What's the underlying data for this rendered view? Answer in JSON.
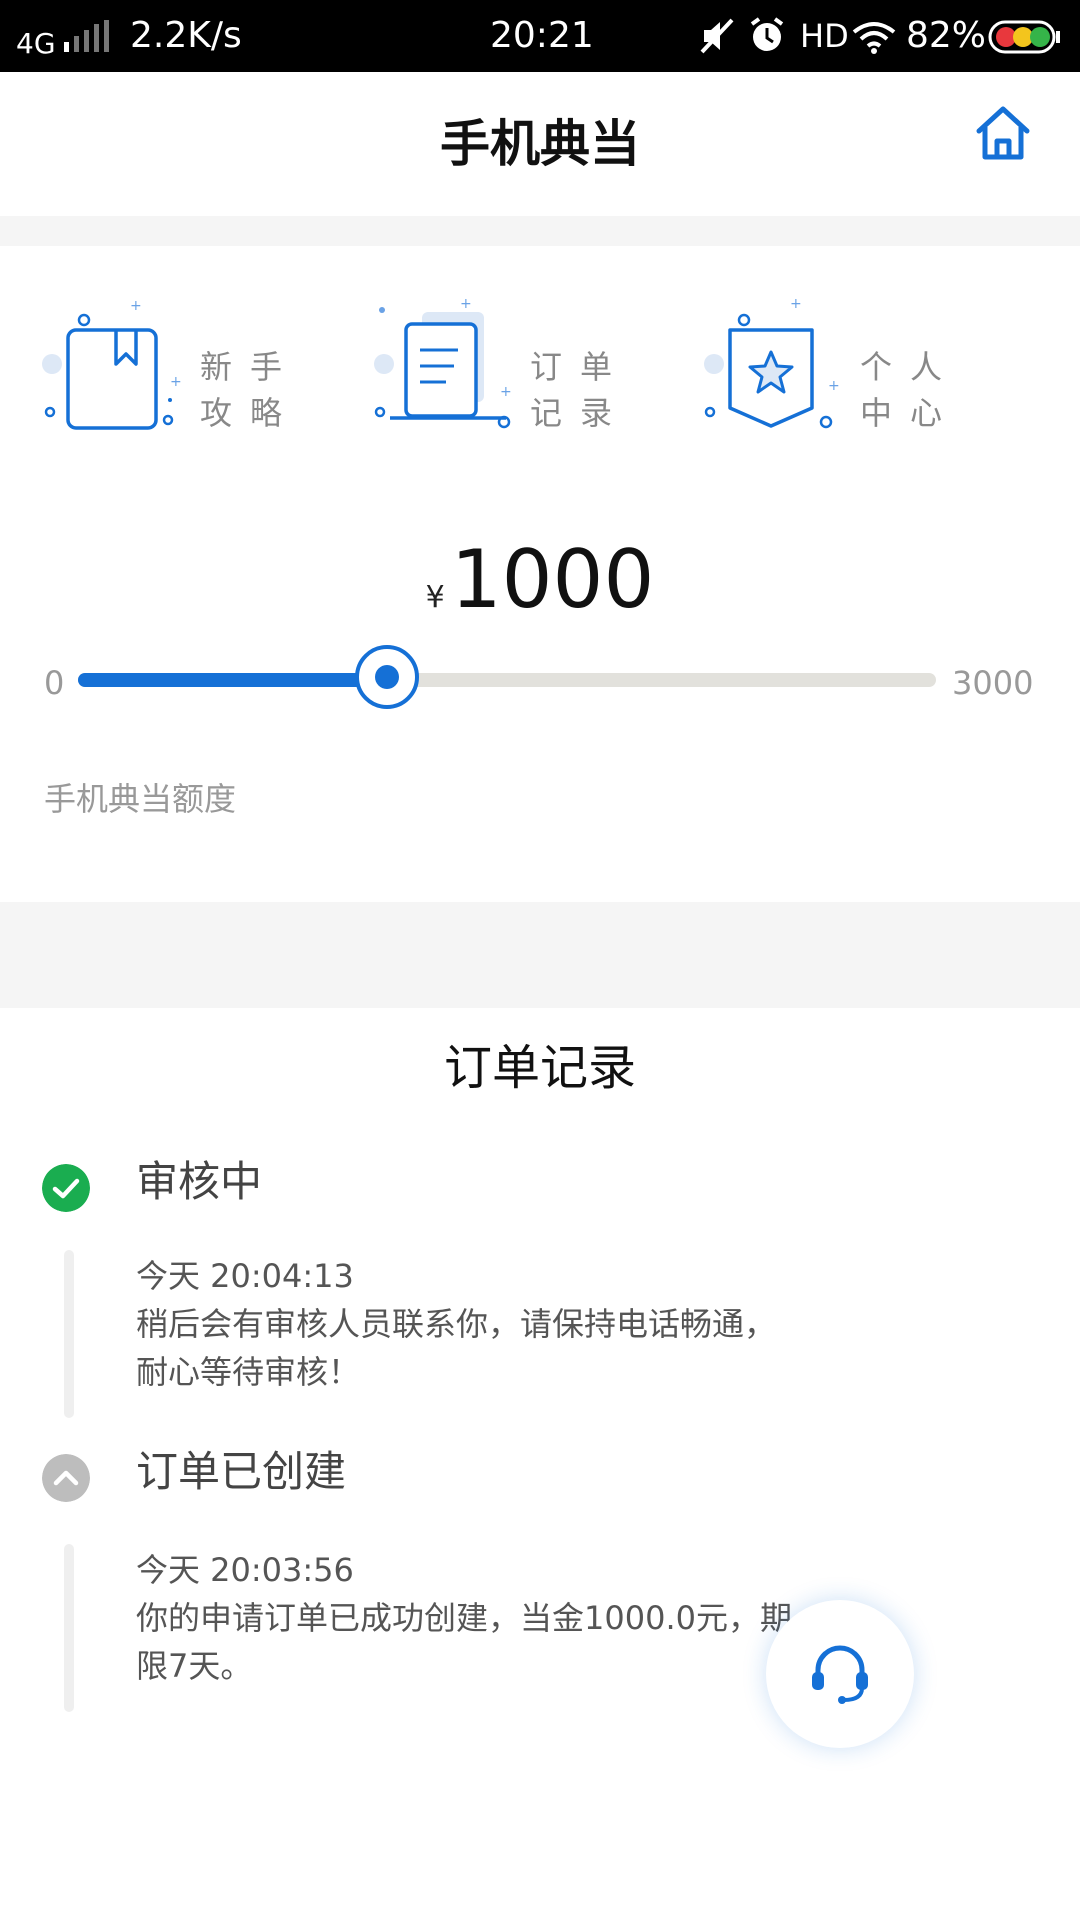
{
  "status_bar": {
    "network": "4G",
    "speed": "2.2K/s",
    "time": "20:21",
    "hd": "HD",
    "battery": "82%"
  },
  "header": {
    "title": "手机典当",
    "home_icon": "home-icon"
  },
  "shortcuts": [
    {
      "line1": "新手",
      "line2": "攻略",
      "icon": "guide-book-icon"
    },
    {
      "line1": "订单",
      "line2": "记录",
      "icon": "order-document-icon"
    },
    {
      "line1": "个人",
      "line2": "中心",
      "icon": "star-badge-icon"
    }
  ],
  "amount": {
    "currency": "¥",
    "value": "1000"
  },
  "slider": {
    "min": "0",
    "max": "3000",
    "value": 1000,
    "label": "手机典当额度"
  },
  "orders": {
    "title": "订单记录",
    "items": [
      {
        "status": "审核中",
        "time": "今天 20:04:13",
        "message_line1": "稍后会有审核人员联系你，请保持电话畅通，",
        "message_line2": "耐心等待审核！",
        "icon": "check-circle-icon"
      },
      {
        "status": "订单已创建",
        "time": "今天 20:03:56",
        "message_line1": "你的申请订单已成功创建，当金1000.0元，期",
        "message_line2": "限7天。",
        "icon": "chevron-up-icon"
      }
    ]
  },
  "colors": {
    "accent": "#1570d6",
    "success": "#1aad50",
    "muted": "#bdbdbd"
  },
  "support_icon": "headset-icon"
}
